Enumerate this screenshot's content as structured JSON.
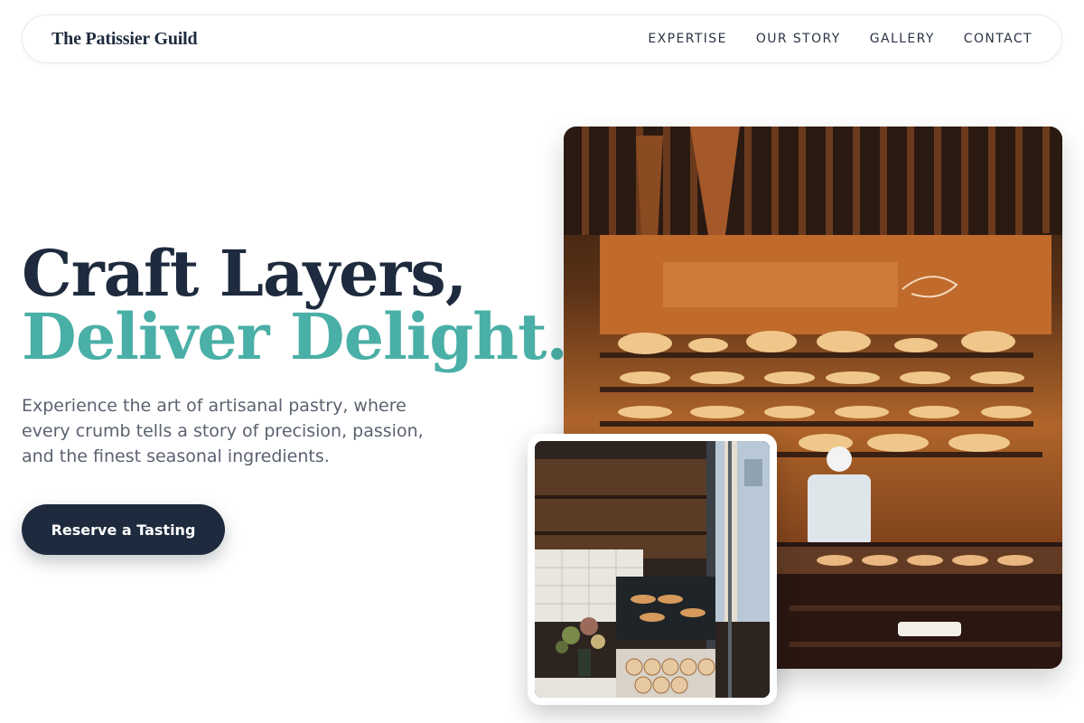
{
  "nav": {
    "brand": "The Patissier Guild",
    "links": [
      "EXPERTISE",
      "OUR STORY",
      "GALLERY",
      "CONTACT"
    ]
  },
  "hero": {
    "title_line1": "Craft Layers,",
    "title_line2": "Deliver Delight.",
    "subtitle": "Experience the art of artisanal pastry, where every crumb tells a story of precision, passion, and the finest seasonal ingredients.",
    "cta_label": "Reserve a Tasting"
  },
  "colors": {
    "navy": "#1e2a3d",
    "teal": "#4aafa6",
    "body_text": "#5a6270"
  },
  "images": {
    "main_photo": "bakery-interior-photo",
    "inset_photo": "bakery-window-photo"
  }
}
